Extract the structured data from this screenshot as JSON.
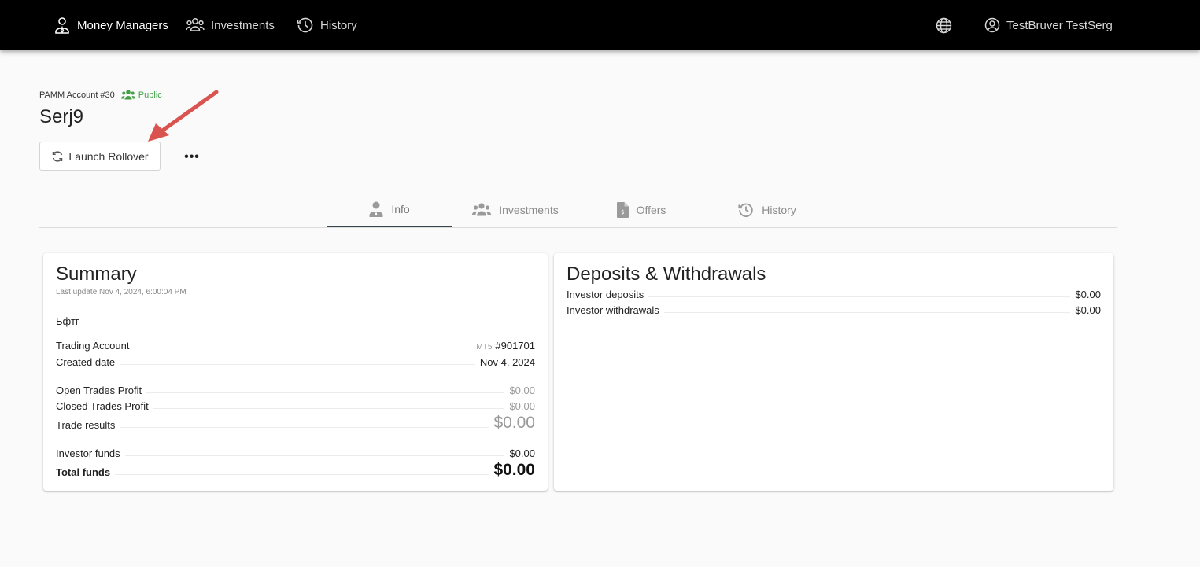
{
  "nav": {
    "money_managers": "Money Managers",
    "investments": "Investments",
    "history": "History",
    "user_name": "TestBruver TestSerg"
  },
  "account": {
    "label": "PAMM Account #30",
    "visibility": "Public",
    "name": "Serj9",
    "rollover_button": "Launch Rollover",
    "more_button": "•••"
  },
  "tabs": [
    {
      "label": "Info",
      "icon": "user-tie-icon",
      "active": true
    },
    {
      "label": "Investments",
      "icon": "users-icon",
      "active": false
    },
    {
      "label": "Offers",
      "icon": "file-invoice-icon",
      "active": false
    },
    {
      "label": "History",
      "icon": "history-icon",
      "active": false
    }
  ],
  "summary": {
    "title": "Summary",
    "last_update": "Last update Nov 4, 2024, 6:00:04 PM",
    "description": "Ьфтг",
    "trading_account_label": "Trading Account",
    "trading_account_platform": "MT5",
    "trading_account_value": "#901701",
    "created_label": "Created date",
    "created_value": "Nov 4, 2024",
    "open_trades_label": "Open Trades Profit",
    "open_trades_value": "$0.00",
    "closed_trades_label": "Closed Trades Profit",
    "closed_trades_value": "$0.00",
    "trade_results_label": "Trade results",
    "trade_results_value": "$0.00",
    "investor_funds_label": "Investor funds",
    "investor_funds_value": "$0.00",
    "total_funds_label": "Total funds",
    "total_funds_value": "$0.00"
  },
  "deposits": {
    "title": "Deposits & Withdrawals",
    "investor_deposits_label": "Investor deposits",
    "investor_deposits_value": "$0.00",
    "investor_withdrawals_label": "Investor withdrawals",
    "investor_withdrawals_value": "$0.00"
  },
  "colors": {
    "topbar": "#000000",
    "public_green": "#43a047",
    "annotation_arrow": "#d9534f",
    "active_tab_underline": "#37474f"
  }
}
